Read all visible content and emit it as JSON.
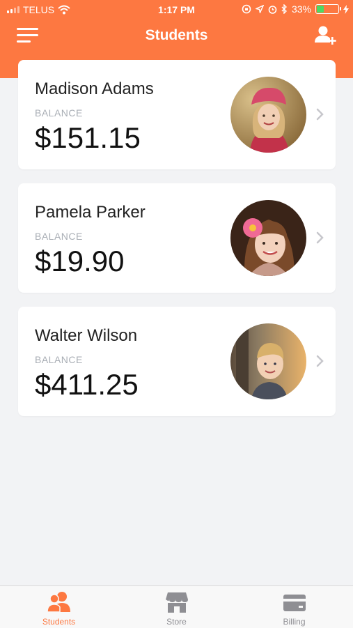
{
  "status_bar": {
    "carrier": "TELUS",
    "time": "1:17 PM",
    "battery": "33%",
    "battery_level": 0.33
  },
  "nav": {
    "title": "Students",
    "menu_icon": "hamburger-icon",
    "add_icon": "add-user-icon"
  },
  "students": [
    {
      "name": "Madison Adams",
      "balance_label": "BALANCE",
      "balance": "$151.15"
    },
    {
      "name": "Pamela Parker",
      "balance_label": "BALANCE",
      "balance": "$19.90"
    },
    {
      "name": "Walter Wilson",
      "balance_label": "BALANCE",
      "balance": "$411.25"
    }
  ],
  "tabs": [
    {
      "label": "Students",
      "icon": "students-icon",
      "active": true
    },
    {
      "label": "Store",
      "icon": "store-icon",
      "active": false
    },
    {
      "label": "Billing",
      "icon": "billing-icon",
      "active": false
    }
  ],
  "colors": {
    "accent": "#fd7841",
    "background": "#f2f3f5",
    "inactive_tab": "#8e8e93"
  }
}
